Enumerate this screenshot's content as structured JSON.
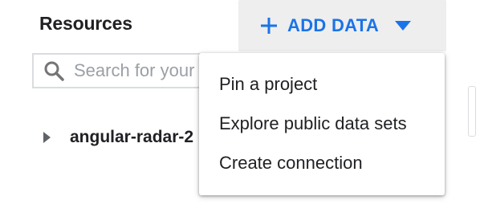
{
  "panel": {
    "title": "Resources"
  },
  "add_data": {
    "label": "ADD DATA",
    "plus_icon": "plus-icon",
    "caret_icon": "caret-down-icon",
    "accent_color": "#1a73e8"
  },
  "search": {
    "placeholder": "Search for your data",
    "value": "",
    "icon": "search-icon"
  },
  "tree": {
    "items": [
      {
        "label": "angular-radar-2",
        "expand_icon": "triangle-right-icon"
      }
    ]
  },
  "menu": {
    "items": [
      {
        "label": "Pin a project"
      },
      {
        "label": "Explore public data sets"
      },
      {
        "label": "Create connection"
      }
    ]
  }
}
